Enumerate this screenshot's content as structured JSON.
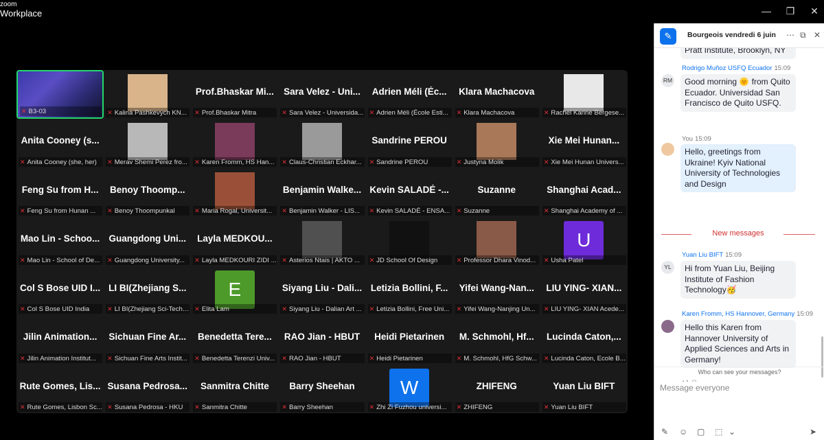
{
  "app": {
    "brand_small": "zoom",
    "brand_large": "Workplace"
  },
  "window": {
    "minimize": "—",
    "restore": "❐",
    "close": "✕"
  },
  "tiles": [
    {
      "label": "B3-03",
      "type": "stage",
      "active": true
    },
    {
      "label": "Kalina Pashkevych KN...",
      "type": "photo",
      "photo": "#d9b48a"
    },
    {
      "label": "Prof.Bhaskar Mitra",
      "type": "name",
      "big": "Prof.Bhaskar Mi..."
    },
    {
      "label": "Sara Velez - Universida...",
      "type": "name",
      "big": "Sara Velez - Uni..."
    },
    {
      "label": "Adrien Méli (École Esti...",
      "type": "name",
      "big": "Adrien Méli (Éc..."
    },
    {
      "label": "Klara Machacova",
      "type": "name",
      "big": "Klara Machacova"
    },
    {
      "label": "Rachel Karine Bergese...",
      "type": "photo",
      "photo": "#e8e8e8"
    },
    {
      "label": "Anita Cooney (she, her)",
      "type": "name",
      "big": "Anita Cooney (s..."
    },
    {
      "label": "Merav Shemi Perez fro...",
      "type": "photo",
      "photo": "#b8b8b8"
    },
    {
      "label": "Karen Fromm, HS Han...",
      "type": "photo",
      "photo": "#7a3a5a"
    },
    {
      "label": "Claus-Christian Eckhar...",
      "type": "photo",
      "photo": "#9a9a9a"
    },
    {
      "label": "Sandrine PEROU",
      "type": "name",
      "big": "Sandrine PEROU"
    },
    {
      "label": "Justyna Molik",
      "type": "photo",
      "photo": "#a87858"
    },
    {
      "label": "Xie Mei Hunan Univers...",
      "type": "name",
      "big": "Xie Mei Hunan..."
    },
    {
      "label": "Feng Su from Hunan ...",
      "type": "name",
      "big": "Feng Su from H..."
    },
    {
      "label": "Benoy Thoompunkal",
      "type": "name",
      "big": "Benoy Thoomp..."
    },
    {
      "label": "Maria Rogal, Universit...",
      "type": "photo",
      "photo": "#9a5038"
    },
    {
      "label": "Benjamin Walker - LIS...",
      "type": "name",
      "big": "Benjamin Walke..."
    },
    {
      "label": "Kevin SALADÉ - ENSA...",
      "type": "name",
      "big": "Kevin SALADÉ -..."
    },
    {
      "label": "Suzanne",
      "type": "name",
      "big": "Suzanne"
    },
    {
      "label": "Shanghai Academy of ...",
      "type": "name",
      "big": "Shanghai Acad..."
    },
    {
      "label": "Mao Lin - School of De...",
      "type": "name",
      "big": "Mao Lin - Schoo..."
    },
    {
      "label": "Guangdong University...",
      "type": "name",
      "big": "Guangdong Uni..."
    },
    {
      "label": "Layla MEDKOURI ZIDI ...",
      "type": "name",
      "big": "Layla MEDKOU..."
    },
    {
      "label": "Asterios Ntais | AKTO ...",
      "type": "photo",
      "photo": "#505050"
    },
    {
      "label": "JD School Of Design",
      "type": "photo",
      "photo": "#111111"
    },
    {
      "label": "Professor Dhara Vinod...",
      "type": "photo",
      "photo": "#8a5a48"
    },
    {
      "label": "Usha Patel",
      "type": "letter",
      "letter": "U",
      "color": "#6d2bd9"
    },
    {
      "label": "Col S Bose UID India",
      "type": "name",
      "big": "Col S Bose UID I..."
    },
    {
      "label": "LI BI(Zhejiang Sci-Tech ...",
      "type": "name",
      "big": "LI BI(Zhejiang S..."
    },
    {
      "label": "Elita Lam",
      "type": "letter",
      "letter": "E",
      "color": "#4d9a2a"
    },
    {
      "label": "Siyang Liu - Dalian Art ...",
      "type": "name",
      "big": "Siyang Liu - Dali..."
    },
    {
      "label": "Letizia Bollini, Free Uni...",
      "type": "name",
      "big": "Letizia Bollini, F..."
    },
    {
      "label": "Yifei Wang-Nanjing Un...",
      "type": "name",
      "big": "Yifei Wang-Nan..."
    },
    {
      "label": "LIU YING- XIAN Acede...",
      "type": "name",
      "big": "LIU YING- XIAN..."
    },
    {
      "label": "Jilin Animation Institut...",
      "type": "name",
      "big": "Jilin Animation..."
    },
    {
      "label": "Sichuan Fine Arts Instit...",
      "type": "name",
      "big": "Sichuan Fine Ar..."
    },
    {
      "label": "Benedetta Terenzi Univ...",
      "type": "name",
      "big": "Benedetta Tere..."
    },
    {
      "label": "RAO Jian - HBUT",
      "type": "name",
      "big": "RAO Jian - HBUT"
    },
    {
      "label": "Heidi Pietarinen",
      "type": "name",
      "big": "Heidi Pietarinen"
    },
    {
      "label": "M. Schmohl, HfG Schw...",
      "type": "name",
      "big": "M. Schmohl, Hf..."
    },
    {
      "label": "Lucinda Caton, Ecole B...",
      "type": "name",
      "big": "Lucinda Caton,..."
    },
    {
      "label": "Rute Gomes, Lisbon Sc...",
      "type": "name",
      "big": "Rute Gomes, Lis..."
    },
    {
      "label": "Susana Pedrosa - HKU",
      "type": "name",
      "big": "Susana Pedrosa..."
    },
    {
      "label": "Sanmitra Chitte",
      "type": "name",
      "big": "Sanmitra Chitte"
    },
    {
      "label": "Barry Sheehan",
      "type": "name",
      "big": "Barry Sheehan"
    },
    {
      "label": "Zhi Zi  Fuzhou universi...",
      "type": "letter",
      "letter": "W",
      "color": "#0e72ed"
    },
    {
      "label": "ZHIFENG",
      "type": "name",
      "big": "ZHIFENG"
    },
    {
      "label": "Yuan Liu BIFT",
      "type": "name",
      "big": "Yuan Liu BIFT"
    }
  ],
  "chat": {
    "recipient": "Bourgeois vendredi 6 juin",
    "more_icon": "⋯",
    "popout_icon": "⧉",
    "close_icon": "✕",
    "top_fragment": "Pratt Institute, Brooklyn, NY",
    "messages": [
      {
        "sender": "Rodrigo Muñoz USFQ Ecuador",
        "time": "15:09",
        "initials": "RM",
        "text": "Good morning 🌞 from Quito Ecuador. Universidad San Francisco de Quito USFQ."
      },
      {
        "sender": "You",
        "time": "15:09",
        "initials": "",
        "text": "Hello, greetings from Ukraine! Kyiv National University of Technologies and Design"
      },
      {
        "sender": "Yuan Liu BIFT",
        "time": "15:09",
        "initials": "YL",
        "text": "Hi from Yuan Liu, Beijing Institute of Fashion Technology🥳"
      },
      {
        "sender": "Karen Fromm, HS Hannover, Germany",
        "time": "15:09",
        "initials": "",
        "text": "Hello this Karen from Hannover University of Applied Sciences and Arts in Germany!"
      }
    ],
    "new_messages": "New messages",
    "who_can_see": "Who can see your messages?",
    "input_placeholder": "Message everyone"
  }
}
